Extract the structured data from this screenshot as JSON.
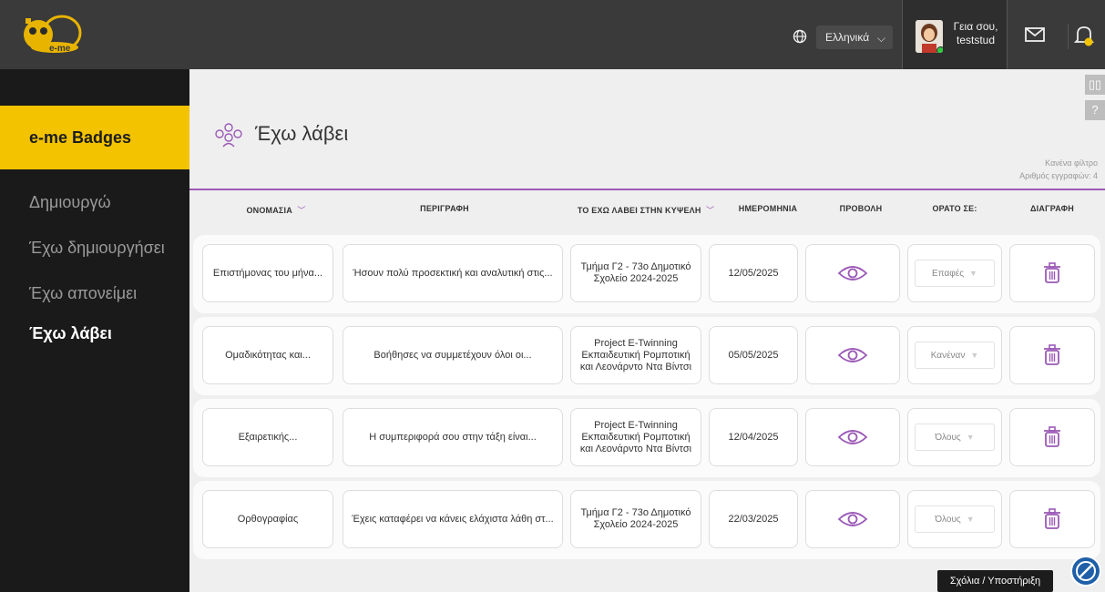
{
  "header": {
    "logo_alt": "e-me",
    "language": "Ελληνικά",
    "greeting_line1": "Γεια σου,",
    "greeting_line2": "teststud"
  },
  "sidebar": {
    "active_section": "e-me Badges",
    "items": [
      {
        "label": "Δημιουργώ",
        "current": false
      },
      {
        "label": "Έχω δημιουργήσει",
        "current": false
      },
      {
        "label": "Έχω απονείμει",
        "current": false
      },
      {
        "label": "Έχω λάβει",
        "current": true
      }
    ]
  },
  "page": {
    "title": "Έχω λάβει",
    "filter_line1": "Κανένα φίλτρο",
    "filter_line2": "Αριθμός εγγραφών: 4"
  },
  "table": {
    "columns": [
      "ΟΝΟΜΑΣΙΑ",
      "ΠΕΡΙΓΡΑΦΗ",
      "ΤΟ ΕΧΩ ΛΑΒΕΙ ΣΤΗΝ ΚΥΨΕΛΗ",
      "ΗΜΕΡΟΜΗΝΙΑ",
      "ΠΡΟΒΟΛΗ",
      "ΟΡΑΤΟ ΣΕ:",
      "ΔΙΑΓΡΑΦΗ"
    ],
    "rows": [
      {
        "name": "Επιστήμονας του μήνα...",
        "description": "Ήσουν πολύ προσεκτική και αναλυτική στις...",
        "hive": "Τμήμα Γ2 - 73ο Δημοτικό Σχολείο 2024-2025",
        "date": "12/05/2025",
        "visible_to": "Επαφές"
      },
      {
        "name": "Ομαδικότητας και...",
        "description": "Βοήθησες να συμμετέχουν όλοι οι...",
        "hive": "Project E-Twinning Εκπαιδευτική Ρομποτική και Λεονάρντο Ντα Βίντσι",
        "date": "05/05/2025",
        "visible_to": "Κανέναν"
      },
      {
        "name": "Εξαιρετικής...",
        "description": "Η συμπεριφορά σου στην τάξη είναι...",
        "hive": "Project E-Twinning Εκπαιδευτική Ρομποτική και Λεονάρντο Ντα Βίντσι",
        "date": "12/04/2025",
        "visible_to": "Όλους"
      },
      {
        "name": "Ορθογραφίας",
        "description": "Έχεις καταφέρει να κάνεις ελάχιστα λάθη στ...",
        "hive": "Τμήμα Γ2 - 73ο Δημοτικό Σχολείο 2024-2025",
        "date": "22/03/2025",
        "visible_to": "Όλους"
      }
    ]
  },
  "footer": {
    "feedback": "Σχόλια / Υποστήριξη"
  },
  "colors": {
    "accent_yellow": "#f3c300",
    "accent_purple": "#9b59b6",
    "topbar": "#3a3a3a",
    "sidebar": "#1a1a1a"
  }
}
